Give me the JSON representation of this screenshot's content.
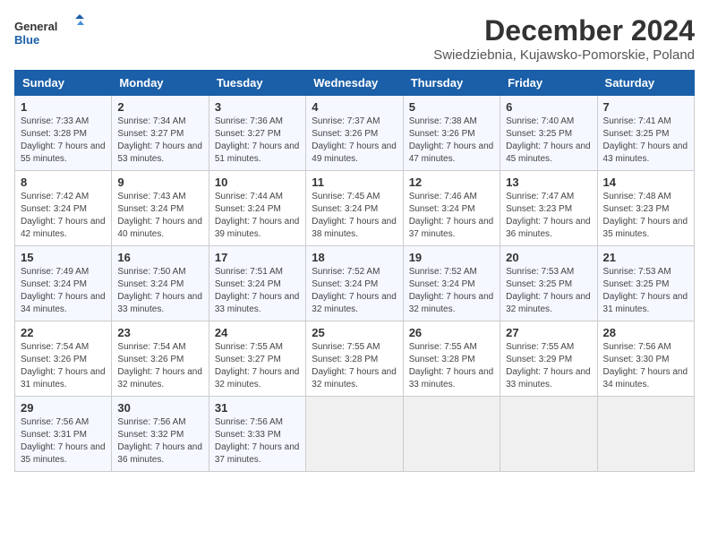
{
  "logo": {
    "text_general": "General",
    "text_blue": "Blue"
  },
  "title": "December 2024",
  "subtitle": "Swiedziebnia, Kujawsko-Pomorskie, Poland",
  "weekdays": [
    "Sunday",
    "Monday",
    "Tuesday",
    "Wednesday",
    "Thursday",
    "Friday",
    "Saturday"
  ],
  "weeks": [
    [
      {
        "day": "1",
        "sunrise": "Sunrise: 7:33 AM",
        "sunset": "Sunset: 3:28 PM",
        "daylight": "Daylight: 7 hours and 55 minutes."
      },
      {
        "day": "2",
        "sunrise": "Sunrise: 7:34 AM",
        "sunset": "Sunset: 3:27 PM",
        "daylight": "Daylight: 7 hours and 53 minutes."
      },
      {
        "day": "3",
        "sunrise": "Sunrise: 7:36 AM",
        "sunset": "Sunset: 3:27 PM",
        "daylight": "Daylight: 7 hours and 51 minutes."
      },
      {
        "day": "4",
        "sunrise": "Sunrise: 7:37 AM",
        "sunset": "Sunset: 3:26 PM",
        "daylight": "Daylight: 7 hours and 49 minutes."
      },
      {
        "day": "5",
        "sunrise": "Sunrise: 7:38 AM",
        "sunset": "Sunset: 3:26 PM",
        "daylight": "Daylight: 7 hours and 47 minutes."
      },
      {
        "day": "6",
        "sunrise": "Sunrise: 7:40 AM",
        "sunset": "Sunset: 3:25 PM",
        "daylight": "Daylight: 7 hours and 45 minutes."
      },
      {
        "day": "7",
        "sunrise": "Sunrise: 7:41 AM",
        "sunset": "Sunset: 3:25 PM",
        "daylight": "Daylight: 7 hours and 43 minutes."
      }
    ],
    [
      {
        "day": "8",
        "sunrise": "Sunrise: 7:42 AM",
        "sunset": "Sunset: 3:24 PM",
        "daylight": "Daylight: 7 hours and 42 minutes."
      },
      {
        "day": "9",
        "sunrise": "Sunrise: 7:43 AM",
        "sunset": "Sunset: 3:24 PM",
        "daylight": "Daylight: 7 hours and 40 minutes."
      },
      {
        "day": "10",
        "sunrise": "Sunrise: 7:44 AM",
        "sunset": "Sunset: 3:24 PM",
        "daylight": "Daylight: 7 hours and 39 minutes."
      },
      {
        "day": "11",
        "sunrise": "Sunrise: 7:45 AM",
        "sunset": "Sunset: 3:24 PM",
        "daylight": "Daylight: 7 hours and 38 minutes."
      },
      {
        "day": "12",
        "sunrise": "Sunrise: 7:46 AM",
        "sunset": "Sunset: 3:24 PM",
        "daylight": "Daylight: 7 hours and 37 minutes."
      },
      {
        "day": "13",
        "sunrise": "Sunrise: 7:47 AM",
        "sunset": "Sunset: 3:23 PM",
        "daylight": "Daylight: 7 hours and 36 minutes."
      },
      {
        "day": "14",
        "sunrise": "Sunrise: 7:48 AM",
        "sunset": "Sunset: 3:23 PM",
        "daylight": "Daylight: 7 hours and 35 minutes."
      }
    ],
    [
      {
        "day": "15",
        "sunrise": "Sunrise: 7:49 AM",
        "sunset": "Sunset: 3:24 PM",
        "daylight": "Daylight: 7 hours and 34 minutes."
      },
      {
        "day": "16",
        "sunrise": "Sunrise: 7:50 AM",
        "sunset": "Sunset: 3:24 PM",
        "daylight": "Daylight: 7 hours and 33 minutes."
      },
      {
        "day": "17",
        "sunrise": "Sunrise: 7:51 AM",
        "sunset": "Sunset: 3:24 PM",
        "daylight": "Daylight: 7 hours and 33 minutes."
      },
      {
        "day": "18",
        "sunrise": "Sunrise: 7:52 AM",
        "sunset": "Sunset: 3:24 PM",
        "daylight": "Daylight: 7 hours and 32 minutes."
      },
      {
        "day": "19",
        "sunrise": "Sunrise: 7:52 AM",
        "sunset": "Sunset: 3:24 PM",
        "daylight": "Daylight: 7 hours and 32 minutes."
      },
      {
        "day": "20",
        "sunrise": "Sunrise: 7:53 AM",
        "sunset": "Sunset: 3:25 PM",
        "daylight": "Daylight: 7 hours and 32 minutes."
      },
      {
        "day": "21",
        "sunrise": "Sunrise: 7:53 AM",
        "sunset": "Sunset: 3:25 PM",
        "daylight": "Daylight: 7 hours and 31 minutes."
      }
    ],
    [
      {
        "day": "22",
        "sunrise": "Sunrise: 7:54 AM",
        "sunset": "Sunset: 3:26 PM",
        "daylight": "Daylight: 7 hours and 31 minutes."
      },
      {
        "day": "23",
        "sunrise": "Sunrise: 7:54 AM",
        "sunset": "Sunset: 3:26 PM",
        "daylight": "Daylight: 7 hours and 32 minutes."
      },
      {
        "day": "24",
        "sunrise": "Sunrise: 7:55 AM",
        "sunset": "Sunset: 3:27 PM",
        "daylight": "Daylight: 7 hours and 32 minutes."
      },
      {
        "day": "25",
        "sunrise": "Sunrise: 7:55 AM",
        "sunset": "Sunset: 3:28 PM",
        "daylight": "Daylight: 7 hours and 32 minutes."
      },
      {
        "day": "26",
        "sunrise": "Sunrise: 7:55 AM",
        "sunset": "Sunset: 3:28 PM",
        "daylight": "Daylight: 7 hours and 33 minutes."
      },
      {
        "day": "27",
        "sunrise": "Sunrise: 7:55 AM",
        "sunset": "Sunset: 3:29 PM",
        "daylight": "Daylight: 7 hours and 33 minutes."
      },
      {
        "day": "28",
        "sunrise": "Sunrise: 7:56 AM",
        "sunset": "Sunset: 3:30 PM",
        "daylight": "Daylight: 7 hours and 34 minutes."
      }
    ],
    [
      {
        "day": "29",
        "sunrise": "Sunrise: 7:56 AM",
        "sunset": "Sunset: 3:31 PM",
        "daylight": "Daylight: 7 hours and 35 minutes."
      },
      {
        "day": "30",
        "sunrise": "Sunrise: 7:56 AM",
        "sunset": "Sunset: 3:32 PM",
        "daylight": "Daylight: 7 hours and 36 minutes."
      },
      {
        "day": "31",
        "sunrise": "Sunrise: 7:56 AM",
        "sunset": "Sunset: 3:33 PM",
        "daylight": "Daylight: 7 hours and 37 minutes."
      },
      null,
      null,
      null,
      null
    ]
  ]
}
